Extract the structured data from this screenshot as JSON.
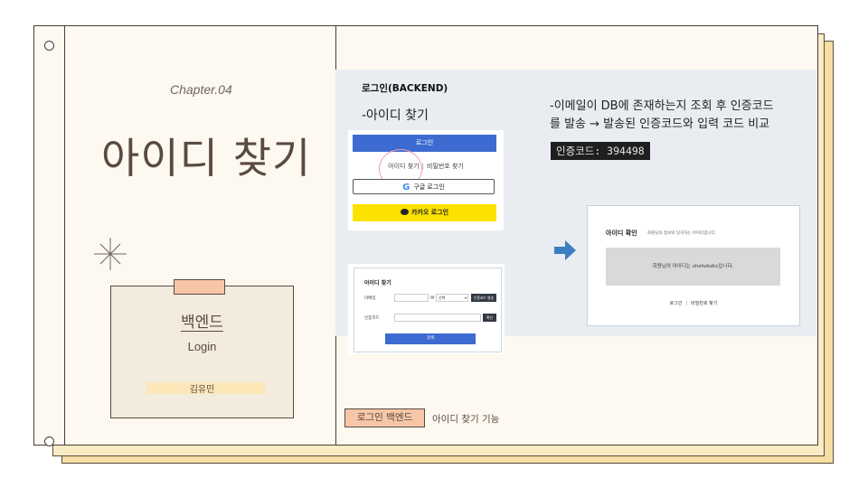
{
  "left_page": {
    "chapter": "Chapter.04",
    "title": "아이디 찾기",
    "card": {
      "title": "백엔드",
      "subtitle": "Login",
      "author": "김유민"
    }
  },
  "right_panel": {
    "heading": "로그인(BACKEND)",
    "subheading": "-아이디 찾기",
    "description_line1": "-이메일이 DB에 존재하는지 조회 후 인증코드",
    "description_line2": "를 발송 → 발송된 인증코드와 입력 코드 비교",
    "code_label": "인증코드: 394498"
  },
  "login_screen": {
    "login_button": "로그인",
    "find_id_link": "아이디 찾기",
    "separator": "|",
    "find_password_link": "비밀번호 찾기",
    "google_button": "구글 로그인",
    "kakao_button": "카카오 로그인"
  },
  "find_id_form": {
    "title": "아이디 찾기",
    "email_label": "이메일",
    "at_sign": "@",
    "domain_select": "선택",
    "send_code_button": "인증코드 발송",
    "code_label": "인증코드",
    "confirm_button": "확인",
    "submit_button": "검색"
  },
  "result_screen": {
    "title": "아이디 확인",
    "description": "회원님의 정보와 일치하는 아이디입니다.",
    "message": "회원님의 아이디는 xhxhzkzkc입니다.",
    "login_link": "로그인",
    "separator": "|",
    "find_password_link": "비밀번호 찾기"
  },
  "footer": {
    "tag": "로그인 백엔드",
    "text": "아이디 찾기 기능"
  },
  "colors": {
    "accent_blue": "#3d6bd1",
    "kakao_yellow": "#fce200",
    "tape_peach": "#f6c6a6",
    "ink_brown": "#5a4a42",
    "arrow_blue": "#3a7fc1"
  }
}
